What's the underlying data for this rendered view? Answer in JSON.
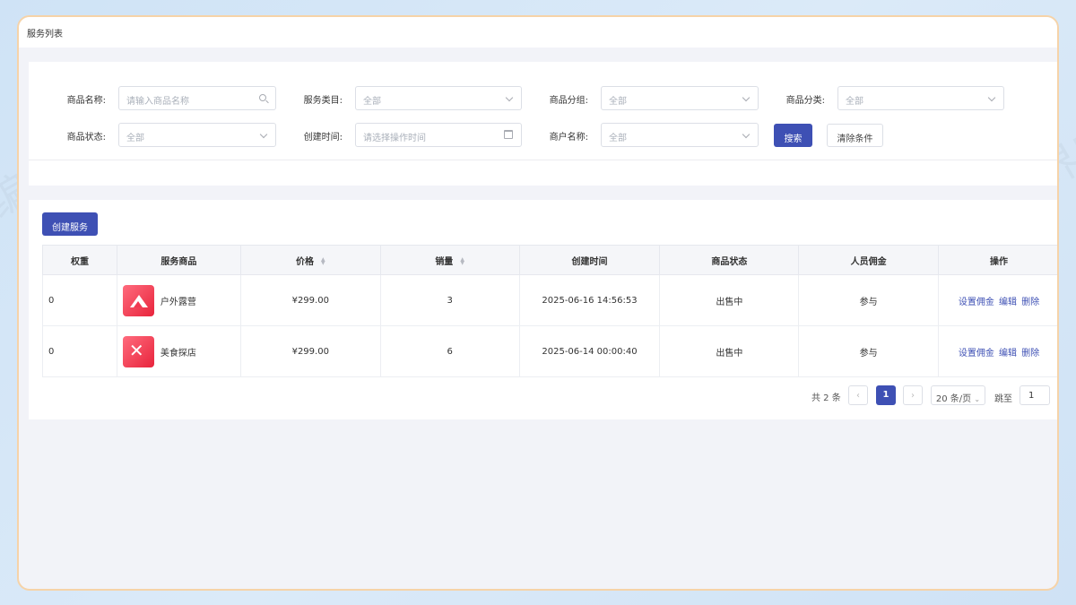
{
  "page_title": "服务列表",
  "filters": {
    "product_name": {
      "label": "商品名称:",
      "placeholder": "请输入商品名称"
    },
    "service_category": {
      "label": "服务类目:",
      "value": "全部"
    },
    "product_group": {
      "label": "商品分组:",
      "value": "全部"
    },
    "product_class": {
      "label": "商品分类:",
      "value": "全部"
    },
    "product_status": {
      "label": "商品状态:",
      "value": "全部"
    },
    "create_time": {
      "label": "创建时间:",
      "placeholder": "请选择操作时间"
    },
    "merchant_name": {
      "label": "商户名称:",
      "value": "全部"
    },
    "search_button": "搜索",
    "clear_button": "清除条件"
  },
  "create_button": "创建服务",
  "table": {
    "columns": [
      "权重",
      "服务商品",
      "价格",
      "销量",
      "创建时间",
      "商品状态",
      "人员佣金",
      "操作"
    ],
    "rows": [
      {
        "weight": "0",
        "product": "户外露营",
        "icon": "mountain-icon",
        "price": "¥299.00",
        "sales": "3",
        "created": "2025-06-16 14:56:53",
        "status": "出售中",
        "commission": "参与",
        "actions": [
          "设置佣金",
          "编辑",
          "删除"
        ]
      },
      {
        "weight": "0",
        "product": "美食探店",
        "icon": "utensils-icon",
        "price": "¥299.00",
        "sales": "6",
        "created": "2025-06-14 00:00:40",
        "status": "出售中",
        "commission": "参与",
        "actions": [
          "设置佣金",
          "编辑",
          "删除"
        ]
      }
    ]
  },
  "pagination": {
    "total": "共 2 条",
    "current_page": "1",
    "page_size": "20 条/页",
    "jump_label": "跳至",
    "jump_value": "1"
  },
  "watermark": "编界感",
  "colors": {
    "primary": "#3e50b4",
    "border_frame": "#f6d3a8",
    "thumb_red": "#e8243c"
  }
}
